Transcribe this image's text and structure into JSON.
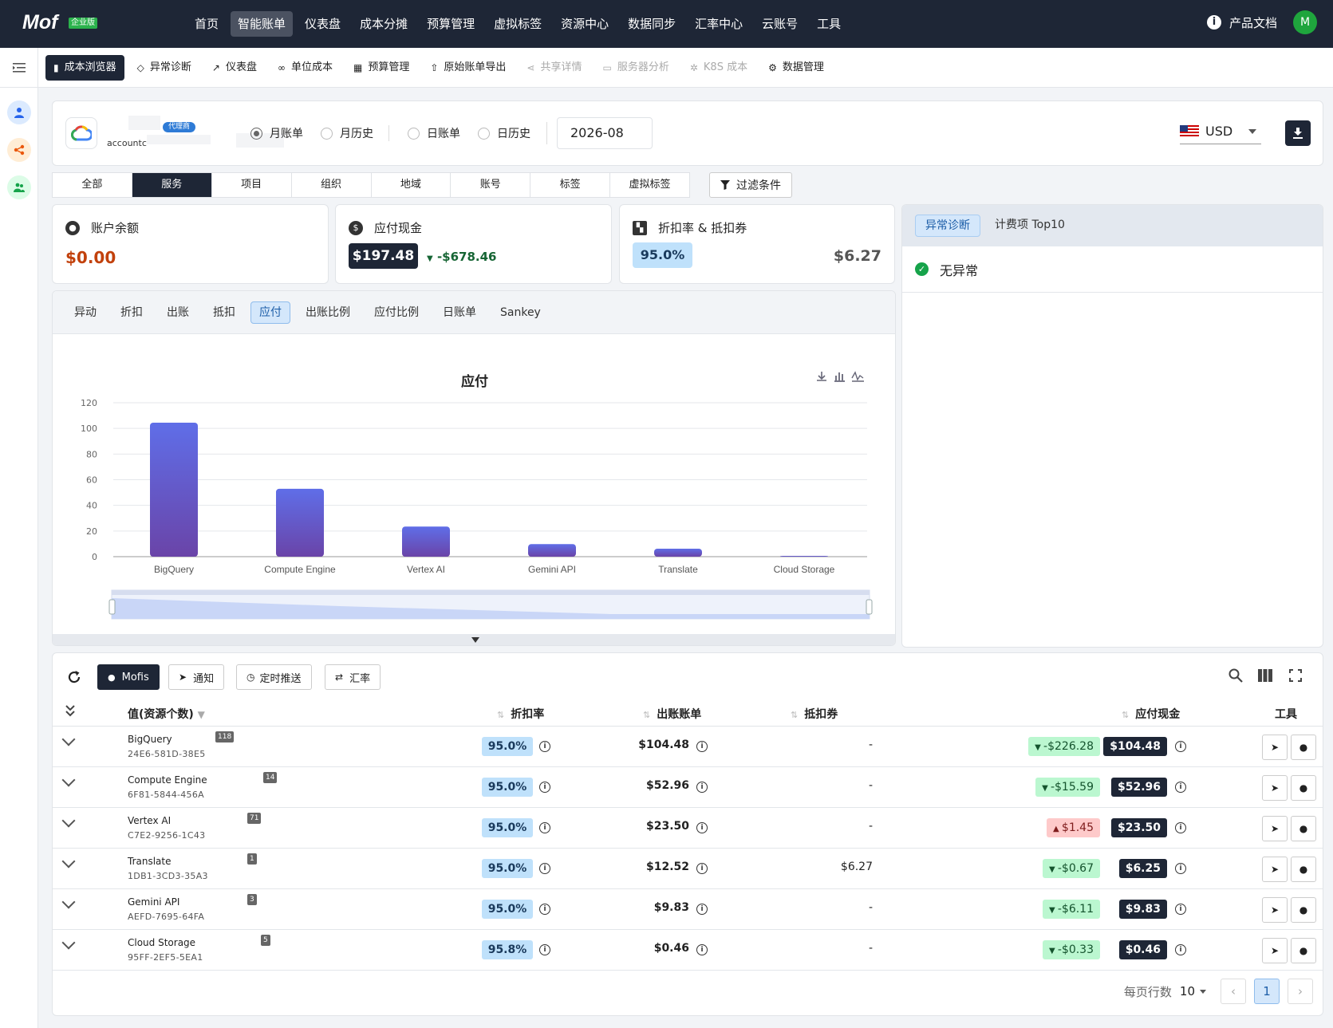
{
  "brand": {
    "logo": "Mof",
    "edition": "企业版"
  },
  "topnav": {
    "items": [
      "首页",
      "智能账单",
      "仪表盘",
      "成本分摊",
      "预算管理",
      "虚拟标签",
      "资源中心",
      "数据同步",
      "汇率中心",
      "云账号",
      "工具"
    ],
    "active_index": 1,
    "docs_label": "产品文档",
    "avatar_initial": "M"
  },
  "subnav": {
    "items": [
      {
        "label": "成本浏览器",
        "icon": "bar-chart-icon",
        "state": "active"
      },
      {
        "label": "异常诊断",
        "icon": "diamond-icon",
        "state": "normal"
      },
      {
        "label": "仪表盘",
        "icon": "line-chart-icon",
        "state": "normal"
      },
      {
        "label": "单位成本",
        "icon": "link-icon",
        "state": "normal"
      },
      {
        "label": "预算管理",
        "icon": "calculator-icon",
        "state": "normal"
      },
      {
        "label": "原始账单导出",
        "icon": "upload-icon",
        "state": "normal"
      },
      {
        "label": "共享详情",
        "icon": "share-icon",
        "state": "disabled"
      },
      {
        "label": "服务器分析",
        "icon": "server-icon",
        "state": "disabled"
      },
      {
        "label": "K8S 成本",
        "icon": "k8s-icon",
        "state": "disabled"
      },
      {
        "label": "数据管理",
        "icon": "gear-icon",
        "state": "normal"
      }
    ]
  },
  "account": {
    "badge": "代理商",
    "name": "accountc",
    "bill_modes": [
      "月账单",
      "月历史",
      "日账单",
      "日历史"
    ],
    "selected_mode": "月账单",
    "month": "2026-08",
    "currency": "USD"
  },
  "dimension_tabs": {
    "items": [
      "全部",
      "服务",
      "项目",
      "组织",
      "地域",
      "账号",
      "标签",
      "虚拟标签"
    ],
    "active": "服务"
  },
  "filter_label": "过滤条件",
  "metrics": {
    "balance": {
      "title": "账户余额",
      "value": "$0.00"
    },
    "payable": {
      "title": "应付现金",
      "value": "$197.48",
      "delta": "-$678.46"
    },
    "discount": {
      "title": "折扣率 & 抵扣券",
      "rate": "95.0%",
      "coupon": "$6.27"
    }
  },
  "diagnosis": {
    "tabs": [
      "异常诊断",
      "计费项 Top10"
    ],
    "active": "异常诊断",
    "status": "无异常"
  },
  "chart_tabs": {
    "items": [
      "异动",
      "折扣",
      "出账",
      "抵扣",
      "应付",
      "出账比例",
      "应付比例",
      "日账单",
      "Sankey"
    ],
    "active": "应付"
  },
  "chart_data": {
    "type": "bar",
    "title": "应付",
    "categories": [
      "BigQuery",
      "Compute Engine",
      "Vertex AI",
      "Gemini API",
      "Translate",
      "Cloud Storage"
    ],
    "values": [
      104.48,
      52.96,
      23.5,
      9.83,
      6.25,
      0.46
    ],
    "ylim": [
      0,
      120
    ],
    "yticks": [
      0,
      20,
      40,
      60,
      80,
      100,
      120
    ],
    "xlabel": "",
    "ylabel": "",
    "grid": true,
    "colors": {
      "bar_top": "#5f6ee8",
      "bar_bottom": "#6a44a8"
    }
  },
  "toolbar": {
    "mofis": "Mofis",
    "notify": "通知",
    "schedule": "定时推送",
    "rate": "汇率"
  },
  "table": {
    "headers": {
      "name": "值(资源个数)",
      "discount": "折扣率",
      "bill": "出账账单",
      "coupon": "抵扣券",
      "payable": "应付现金",
      "tools": "工具"
    },
    "rows": [
      {
        "name": "BigQuery",
        "count": "118",
        "id": "24E6-581D-38E5",
        "discount": "95.0%",
        "bill": "$104.48",
        "coupon": "-",
        "delta": "-$226.28",
        "delta_dir": "down",
        "payable": "$104.48"
      },
      {
        "name": "Compute Engine",
        "count": "14",
        "id": "6F81-5844-456A",
        "discount": "95.0%",
        "bill": "$52.96",
        "coupon": "-",
        "delta": "-$15.59",
        "delta_dir": "down",
        "payable": "$52.96"
      },
      {
        "name": "Vertex AI",
        "count": "71",
        "id": "C7E2-9256-1C43",
        "discount": "95.0%",
        "bill": "$23.50",
        "coupon": "-",
        "delta": "$1.45",
        "delta_dir": "up",
        "payable": "$23.50"
      },
      {
        "name": "Translate",
        "count": "1",
        "id": "1DB1-3CD3-35A3",
        "discount": "95.0%",
        "bill": "$12.52",
        "coupon": "$6.27",
        "delta": "-$0.67",
        "delta_dir": "down",
        "payable": "$6.25"
      },
      {
        "name": "Gemini API",
        "count": "3",
        "id": "AEFD-7695-64FA",
        "discount": "95.0%",
        "bill": "$9.83",
        "coupon": "-",
        "delta": "-$6.11",
        "delta_dir": "down",
        "payable": "$9.83"
      },
      {
        "name": "Cloud Storage",
        "count": "5",
        "id": "95FF-2EF5-5EA1",
        "discount": "95.8%",
        "bill": "$0.46",
        "coupon": "-",
        "delta": "-$0.33",
        "delta_dir": "down",
        "payable": "$0.46"
      }
    ]
  },
  "pagination": {
    "label": "每页行数",
    "page_size": "10",
    "current_page": "1"
  }
}
